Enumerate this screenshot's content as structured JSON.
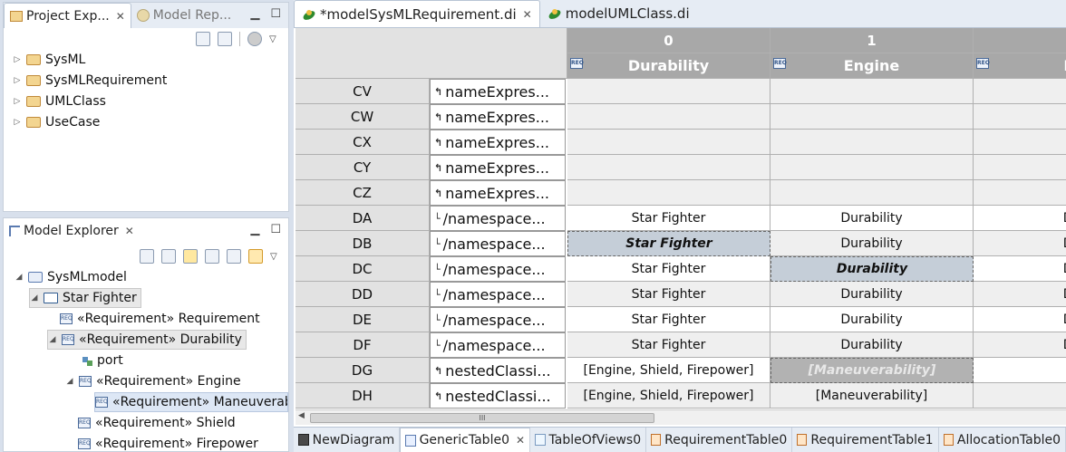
{
  "project_explorer": {
    "tabs": [
      {
        "label": "Project Exp..."
      },
      {
        "label": "Model Rep..."
      }
    ],
    "items": [
      {
        "label": "SysML"
      },
      {
        "label": "SysMLRequirement"
      },
      {
        "label": "UMLClass"
      },
      {
        "label": "UseCase"
      }
    ]
  },
  "model_explorer": {
    "tab_label": "Model Explorer",
    "tree": [
      {
        "label": "SysMLmodel",
        "level": 0,
        "kind": "model"
      },
      {
        "label": "Star Fighter",
        "level": 1,
        "kind": "package"
      },
      {
        "label": "«Requirement» Requirement",
        "level": 2,
        "kind": "requirement"
      },
      {
        "label": "«Requirement» Durability",
        "level": 2,
        "kind": "requirement"
      },
      {
        "label": "port",
        "level": 3,
        "kind": "port"
      },
      {
        "label": "«Requirement» Engine",
        "level": 3,
        "kind": "requirement"
      },
      {
        "label": "«Requirement» Maneuverabi",
        "level": 4,
        "kind": "requirement"
      },
      {
        "label": "«Requirement» Shield",
        "level": 3,
        "kind": "requirement"
      },
      {
        "label": "«Requirement» Firepower",
        "level": 3,
        "kind": "requirement"
      }
    ]
  },
  "editor": {
    "tabs": [
      {
        "label": "*modelSysMLRequirement.di"
      },
      {
        "label": "modelUMLClass.di"
      }
    ],
    "columns": [
      {
        "index": "0",
        "name": "Durability"
      },
      {
        "index": "1",
        "name": "Engine"
      },
      {
        "index": "",
        "name": "Fir"
      }
    ],
    "rows": [
      {
        "header": "CV",
        "label": "nameExpres...",
        "icon": "↰",
        "cells": [
          "",
          "",
          ""
        ]
      },
      {
        "header": "CW",
        "label": "nameExpres...",
        "icon": "↰",
        "cells": [
          "",
          "",
          ""
        ]
      },
      {
        "header": "CX",
        "label": "nameExpres...",
        "icon": "↰",
        "cells": [
          "",
          "",
          ""
        ]
      },
      {
        "header": "CY",
        "label": "nameExpres...",
        "icon": "↰",
        "cells": [
          "",
          "",
          ""
        ]
      },
      {
        "header": "CZ",
        "label": "nameExpres...",
        "icon": "↰",
        "cells": [
          "",
          "",
          ""
        ]
      },
      {
        "header": "DA",
        "label": "/namespace...",
        "icon": "└",
        "cells": [
          "Star Fighter",
          "Durability",
          "Dur"
        ]
      },
      {
        "header": "DB",
        "label": "/namespace...",
        "icon": "└",
        "cells": [
          "Star Fighter",
          "Durability",
          "Dur"
        ]
      },
      {
        "header": "DC",
        "label": "/namespace...",
        "icon": "└",
        "cells": [
          "Star Fighter",
          "Durability",
          "Dur"
        ]
      },
      {
        "header": "DD",
        "label": "/namespace...",
        "icon": "└",
        "cells": [
          "Star Fighter",
          "Durability",
          "Dur"
        ]
      },
      {
        "header": "DE",
        "label": "/namespace...",
        "icon": "└",
        "cells": [
          "Star Fighter",
          "Durability",
          "Dur"
        ]
      },
      {
        "header": "DF",
        "label": "/namespace...",
        "icon": "└",
        "cells": [
          "Star Fighter",
          "Durability",
          "Dur"
        ]
      },
      {
        "header": "DG",
        "label": "nestedClassi...",
        "icon": "↰",
        "cells": [
          "[Engine, Shield, Firepower]",
          "[Maneuverability]",
          ""
        ]
      },
      {
        "header": "DH",
        "label": "nestedClassi...",
        "icon": "↰",
        "cells": [
          "[Engine, Shield, Firepower]",
          "[Maneuverability]",
          ""
        ]
      }
    ],
    "scroll_thumb": "III",
    "bottom_tabs": [
      {
        "label": "NewDiagram"
      },
      {
        "label": "GenericTable0"
      },
      {
        "label": "TableOfViews0"
      },
      {
        "label": "RequirementTable0"
      },
      {
        "label": "RequirementTable1"
      },
      {
        "label": "AllocationTable0"
      }
    ]
  }
}
